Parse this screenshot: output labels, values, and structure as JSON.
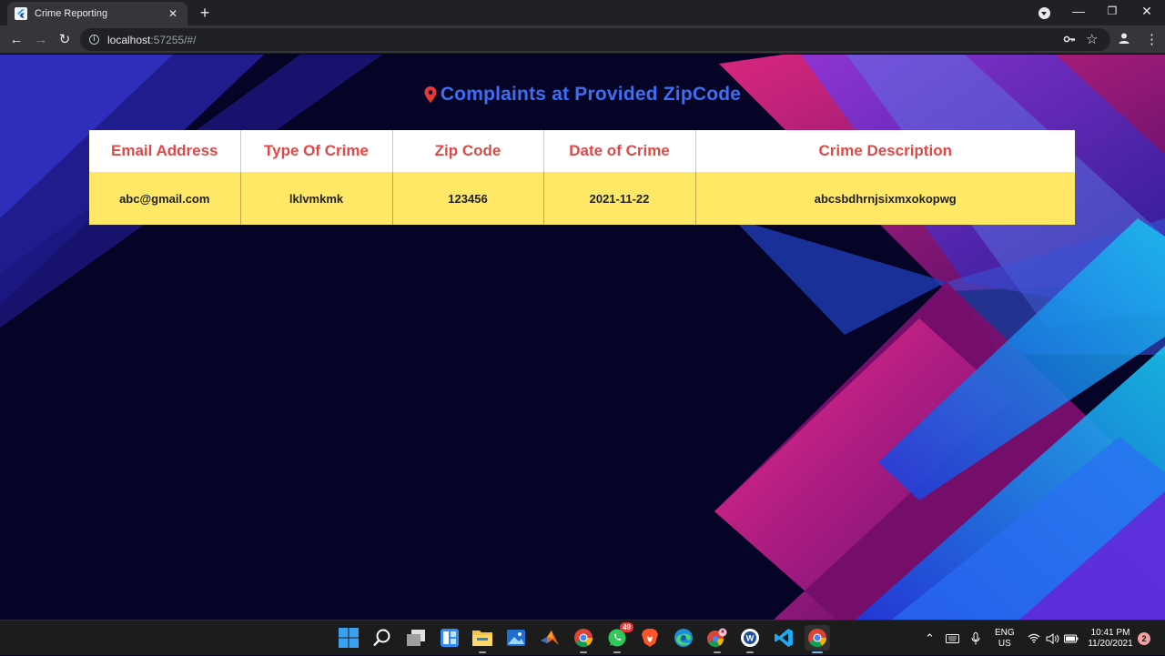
{
  "browser": {
    "tab_title": "Crime Reporting",
    "tab_close": "✕",
    "new_tab": "+",
    "url_host": "localhost",
    "url_rest": ":57255/#/"
  },
  "page": {
    "heading": "Complaints at Provided ZipCode",
    "table": {
      "headers": [
        "Email Address",
        "Type Of Crime",
        "Zip Code",
        "Date of Crime",
        "Crime Description"
      ],
      "rows": [
        [
          "abc@gmail.com",
          "lklvmkmk",
          "123456",
          "2021-11-22",
          "abcsbdhrnjsixmxokopwg"
        ]
      ]
    }
  },
  "taskbar": {
    "whatsapp_badge": "49",
    "lang_line1": "ENG",
    "lang_line2": "US",
    "time": "10:41 PM",
    "date": "11/20/2021",
    "notifications": "2"
  },
  "colors": {
    "heading": "#3b6ff5",
    "header_text": "#e04848",
    "row_bg": "#ffe866",
    "page_bg": "#060426"
  }
}
